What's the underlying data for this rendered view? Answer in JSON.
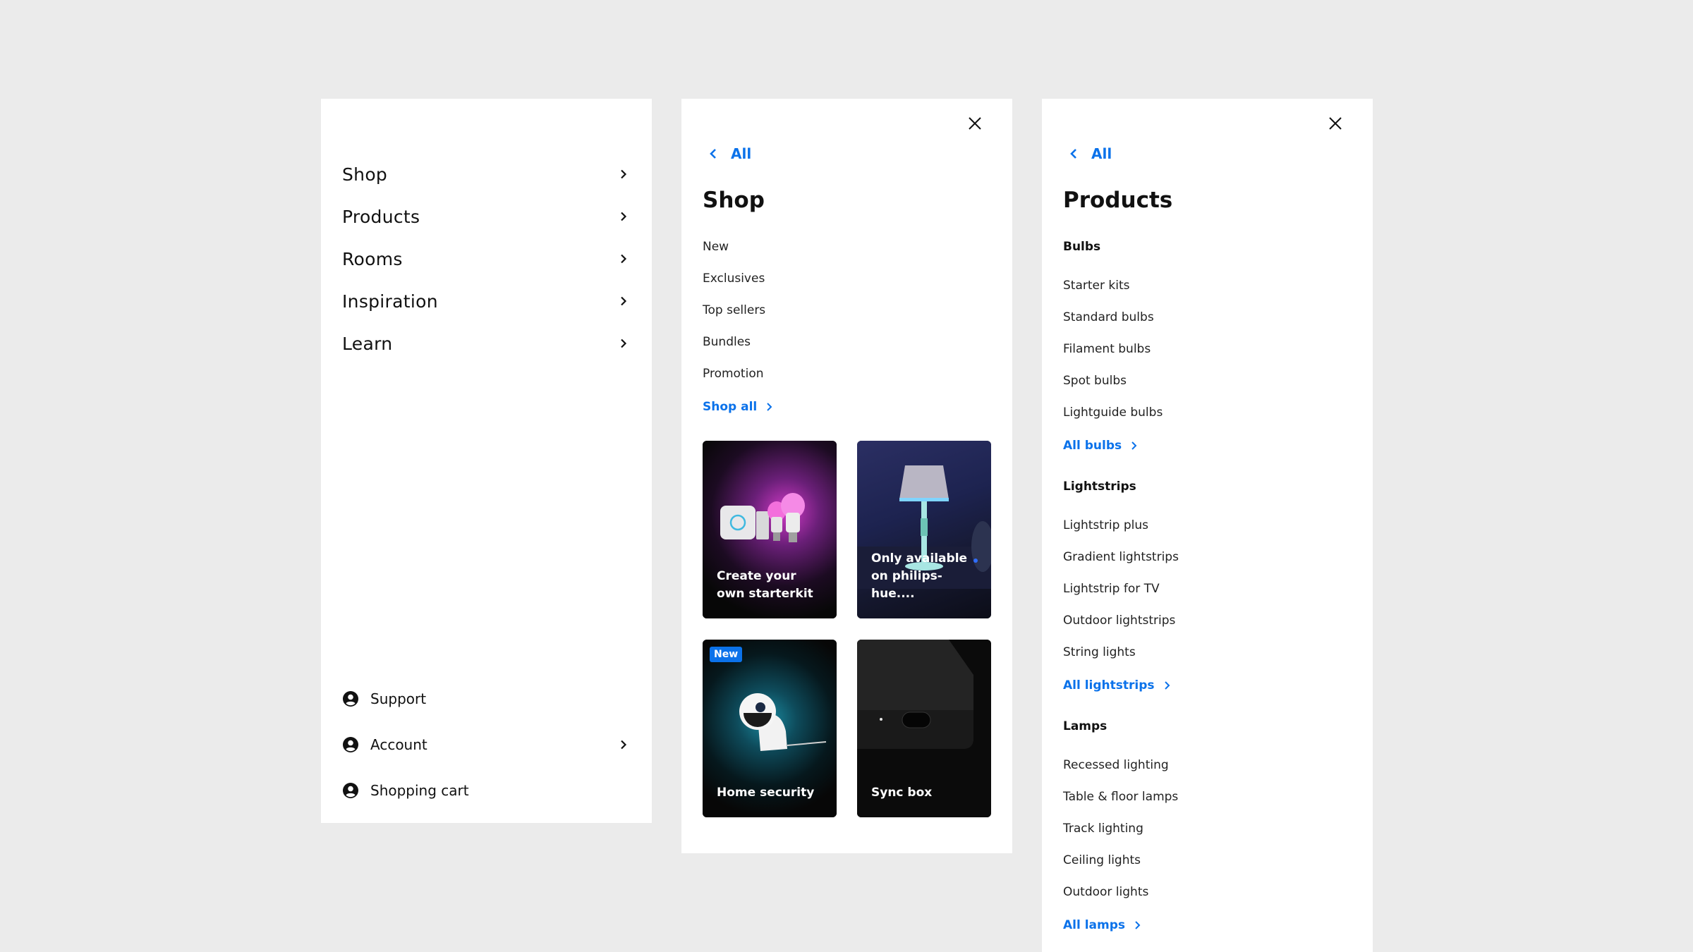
{
  "colors": {
    "background": "#ebebeb",
    "panel": "#ffffff",
    "accent_blue": "#0b72ea",
    "text": "#111111"
  },
  "main_menu": {
    "items": [
      {
        "label": "Shop",
        "icon": "chevron-right-icon"
      },
      {
        "label": "Products",
        "icon": "chevron-right-icon"
      },
      {
        "label": "Rooms",
        "icon": "chevron-right-icon"
      },
      {
        "label": "Inspiration",
        "icon": "chevron-right-icon"
      },
      {
        "label": "Learn",
        "icon": "chevron-right-icon"
      }
    ],
    "utility_items": [
      {
        "label": "Support",
        "icon": "user-circle-icon",
        "has_chevron": false
      },
      {
        "label": "Account",
        "icon": "user-circle-icon",
        "has_chevron": true
      },
      {
        "label": "Shopping cart",
        "icon": "user-circle-icon",
        "has_chevron": false
      }
    ]
  },
  "shop_panel": {
    "back_label": "All",
    "title": "Shop",
    "close_icon": "close-icon",
    "items": [
      "New",
      "Exclusives",
      "Top sellers",
      "Bundles",
      "Promotion"
    ],
    "all_link": "Shop all",
    "cards": [
      {
        "label": "Create your own starterkit",
        "badge": null
      },
      {
        "label": "Only available on philips-hue....",
        "badge": null
      },
      {
        "label": "Home security",
        "badge": "New"
      },
      {
        "label": "Sync box",
        "badge": null
      }
    ]
  },
  "products_panel": {
    "back_label": "All",
    "title": "Products",
    "close_icon": "close-icon",
    "sections": [
      {
        "heading": "Bulbs",
        "items": [
          "Starter kits",
          "Standard bulbs",
          "Filament bulbs",
          "Spot bulbs",
          "Lightguide bulbs"
        ],
        "all_link": "All bulbs"
      },
      {
        "heading": "Lightstrips",
        "items": [
          "Lightstrip plus",
          "Gradient lightstrips",
          "Lightstrip for TV",
          "Outdoor lightstrips",
          "String lights"
        ],
        "all_link": "All lightstrips"
      },
      {
        "heading": "Lamps",
        "items": [
          "Recessed lighting",
          "Table & floor lamps",
          "Track lighting",
          "Ceiling lights",
          "Outdoor lights"
        ],
        "all_link": "All lamps"
      }
    ]
  }
}
